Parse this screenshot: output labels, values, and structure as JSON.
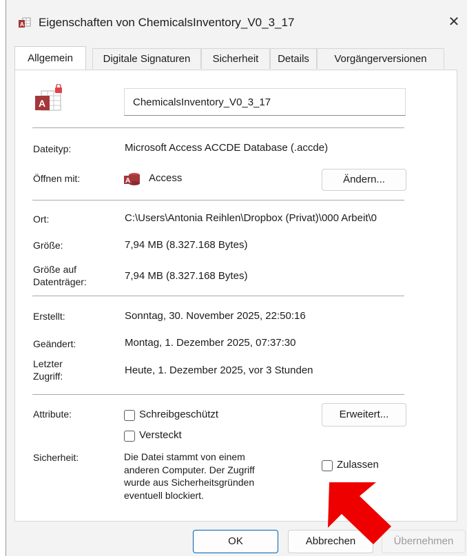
{
  "window": {
    "title": "Eigenschaften von ChemicalsInventory_V0_3_17",
    "close_label": "✕"
  },
  "tabs": [
    {
      "label": "Allgemein",
      "active": true
    },
    {
      "label": "Digitale Signaturen",
      "active": false
    },
    {
      "label": "Sicherheit",
      "active": false
    },
    {
      "label": "Details",
      "active": false
    },
    {
      "label": "Vorgängerversionen",
      "active": false
    }
  ],
  "general": {
    "file_name": "ChemicalsInventory_V0_3_17",
    "file_type_label": "Dateityp:",
    "file_type_value": "Microsoft Access ACCDE Database (.accde)",
    "opens_with_label": "Öffnen mit:",
    "opens_with_value": "Access",
    "change_button": "Ändern...",
    "location_label": "Ort:",
    "location_value": "C:\\Users\\Antonia Reihlen\\Dropbox (Privat)\\000 Arbeit\\0",
    "size_label": "Größe:",
    "size_value": "7,94 MB (8.327.168 Bytes)",
    "size_on_disk_label_1": "Größe auf",
    "size_on_disk_label_2": "Datenträger:",
    "size_on_disk_value": "7,94 MB (8.327.168 Bytes)",
    "created_label": "Erstellt:",
    "created_value": "Sonntag, 30. November 2025, 22:50:16",
    "modified_label": "Geändert:",
    "modified_value": "Montag, 1. Dezember 2025, 07:37:30",
    "accessed_label_1": "Letzter",
    "accessed_label_2": "Zugriff:",
    "accessed_value": "Heute, 1. Dezember 2025, vor 3 Stunden",
    "attributes_label": "Attribute:",
    "readonly_label": "Schreibgeschützt",
    "hidden_label": "Versteckt",
    "advanced_button": "Erweitert...",
    "security_label": "Sicherheit:",
    "security_text": [
      "Die Datei stammt von einem",
      "anderen Computer. Der Zugriff",
      "wurde aus Sicherheitsgründen",
      "eventuell blockiert."
    ],
    "unblock_label": "Zulassen"
  },
  "footer": {
    "ok": "OK",
    "cancel": "Abbrechen",
    "apply": "Übernehmen"
  },
  "colors": {
    "access_red": "#a4373a",
    "annotation_arrow": "#ee0000"
  }
}
